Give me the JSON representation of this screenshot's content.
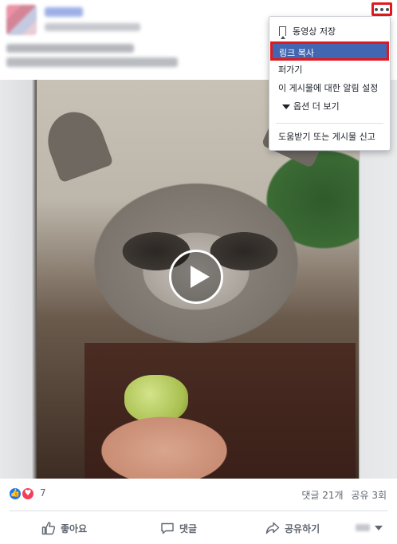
{
  "post": {
    "more_icon": "ellipsis-icon"
  },
  "menu": {
    "save_video": "동영상 저장",
    "copy_link": "링크 복사",
    "share": "퍼가기",
    "notifications": "이 게시물에 대한 알림 설정",
    "more_options": "옵션 더 보기",
    "report": "도움받기 또는 게시물 신고",
    "highlight_color": "#4267b2",
    "outline_color": "#e0191f"
  },
  "video": {
    "play_icon": "play-icon"
  },
  "stats": {
    "reaction_count": "7",
    "comments": "댓글 21개",
    "shares": "공유 3회"
  },
  "actions": {
    "like": "좋아요",
    "comment": "댓글",
    "share": "공유하기"
  }
}
